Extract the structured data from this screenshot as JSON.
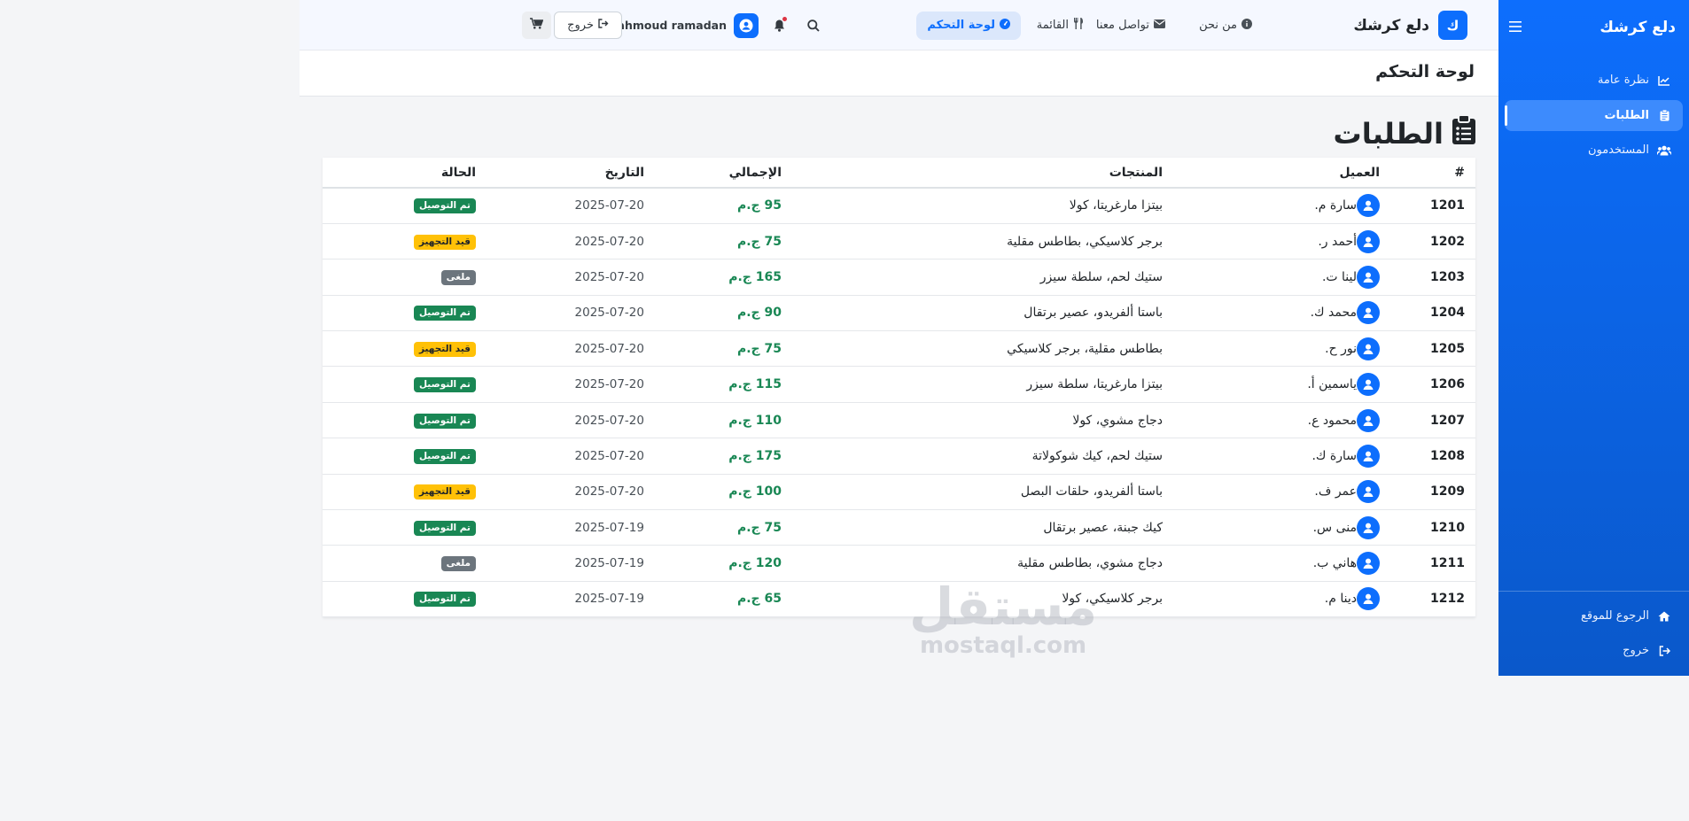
{
  "app": {
    "name": "دلع كرشك",
    "logo_letter": "ك"
  },
  "sidebar": {
    "brand": "دلع كرشك",
    "items": [
      {
        "label": "نظرة عامة",
        "icon": "chart-line-icon"
      },
      {
        "label": "الطلبات",
        "icon": "clipboard-icon",
        "active": true
      },
      {
        "label": "المستخدمون",
        "icon": "users-icon"
      }
    ],
    "bottom": [
      {
        "label": "الرجوع للموقع",
        "icon": "home-icon"
      },
      {
        "label": "خروج",
        "icon": "sign-out-icon"
      }
    ]
  },
  "topbar": {
    "nav": [
      {
        "label": "من نحن",
        "icon": "info-circle-icon"
      },
      {
        "label": "تواصل معنا",
        "icon": "envelope-icon"
      },
      {
        "label": "القائمة",
        "icon": "utensils-icon"
      },
      {
        "label": "لوحة التحكم",
        "icon": "dashboard-icon",
        "active": true
      }
    ],
    "user_name": "mahmoud ramadan",
    "logout_label": "خروج"
  },
  "header": {
    "title": "لوحة التحكم"
  },
  "orders": {
    "title": "الطلبات",
    "columns": [
      "#",
      "العميل",
      "المنتجات",
      "الإجمالي",
      "التاريخ",
      "الحالة"
    ],
    "rows": [
      {
        "id": "1201",
        "client": "سارة م.",
        "products": "بيتزا مارغريتا، كولا",
        "total": "95 ج.م",
        "date": "2025-07-20",
        "status": "تم التوصيل",
        "status_type": "success"
      },
      {
        "id": "1202",
        "client": "أحمد ر.",
        "products": "برجر كلاسيكي، بطاطس مقلية",
        "total": "75 ج.م",
        "date": "2025-07-20",
        "status": "قيد التجهيز",
        "status_type": "warning"
      },
      {
        "id": "1203",
        "client": "لينا ت.",
        "products": "ستيك لحم، سلطة سيزر",
        "total": "165 ج.م",
        "date": "2025-07-20",
        "status": "ملغى",
        "status_type": "muted"
      },
      {
        "id": "1204",
        "client": "محمد ك.",
        "products": "باستا ألفريدو، عصير برتقال",
        "total": "90 ج.م",
        "date": "2025-07-20",
        "status": "تم التوصيل",
        "status_type": "success"
      },
      {
        "id": "1205",
        "client": "نور ح.",
        "products": "بطاطس مقلية، برجر كلاسيكي",
        "total": "75 ج.م",
        "date": "2025-07-20",
        "status": "قيد التجهيز",
        "status_type": "warning"
      },
      {
        "id": "1206",
        "client": "ياسمين أ.",
        "products": "بيتزا مارغريتا، سلطة سيزر",
        "total": "115 ج.م",
        "date": "2025-07-20",
        "status": "تم التوصيل",
        "status_type": "success"
      },
      {
        "id": "1207",
        "client": "محمود ع.",
        "products": "دجاج مشوي، كولا",
        "total": "110 ج.م",
        "date": "2025-07-20",
        "status": "تم التوصيل",
        "status_type": "success"
      },
      {
        "id": "1208",
        "client": "سارة ك.",
        "products": "ستيك لحم، كيك شوكولاتة",
        "total": "175 ج.م",
        "date": "2025-07-20",
        "status": "تم التوصيل",
        "status_type": "success"
      },
      {
        "id": "1209",
        "client": "عمر ف.",
        "products": "باستا ألفريدو، حلقات البصل",
        "total": "100 ج.م",
        "date": "2025-07-20",
        "status": "قيد التجهيز",
        "status_type": "warning"
      },
      {
        "id": "1210",
        "client": "منى س.",
        "products": "كيك جبنة، عصير برتقال",
        "total": "75 ج.م",
        "date": "2025-07-19",
        "status": "تم التوصيل",
        "status_type": "success"
      },
      {
        "id": "1211",
        "client": "هاني ب.",
        "products": "دجاج مشوي، بطاطس مقلية",
        "total": "120 ج.م",
        "date": "2025-07-19",
        "status": "ملغى",
        "status_type": "muted"
      },
      {
        "id": "1212",
        "client": "دينا م.",
        "products": "برجر كلاسيكي، كولا",
        "total": "65 ج.م",
        "date": "2025-07-19",
        "status": "تم التوصيل",
        "status_type": "success"
      }
    ]
  },
  "watermark": {
    "arabic": "مستقل",
    "latin": "mostaql.com"
  },
  "colors": {
    "primary": "#0d6efd",
    "success": "#198754",
    "warning": "#ffc107",
    "muted": "#6c757d"
  }
}
